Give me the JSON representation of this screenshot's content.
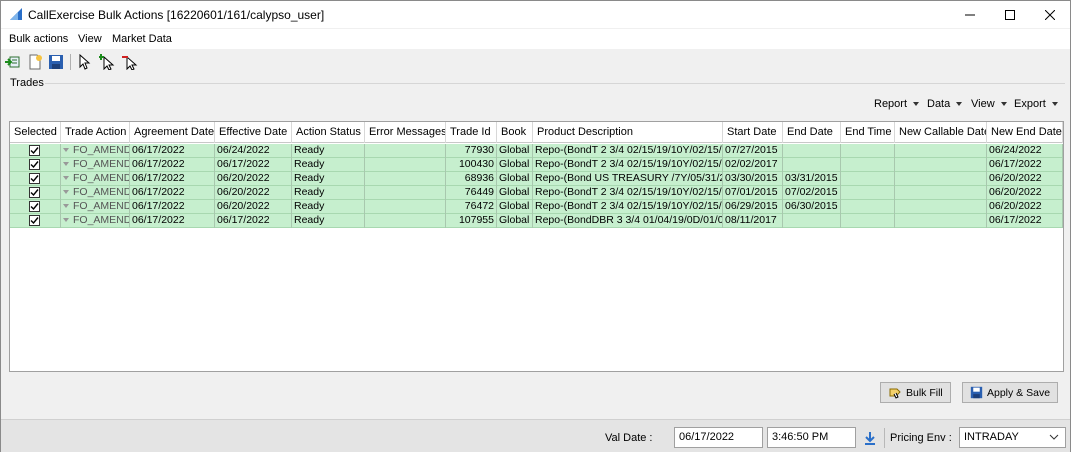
{
  "window": {
    "title": "CallExercise Bulk Actions [16220601/161/calypso_user]",
    "app_icon": "calypso-logo-icon"
  },
  "menu": [
    "Bulk actions",
    "View",
    "Market Data"
  ],
  "toolbar_icons": [
    "import-icon",
    "new-doc-icon",
    "save-icon",
    "pointer-icon",
    "pointer-add-icon",
    "pointer-remove-icon"
  ],
  "group": {
    "title": "Trades"
  },
  "table_actions": [
    "Report",
    "Data",
    "View",
    "Export"
  ],
  "table": {
    "columns": [
      "Selected",
      "Trade Action",
      "Agreement Date",
      "Effective Date",
      "Action Status",
      "Error Messages",
      "Trade Id",
      "Book",
      "Product Description",
      "Start Date",
      "End Date",
      "End Time",
      "New Callable Date",
      "New End Date"
    ],
    "rows": [
      [
        "",
        "FO_AMEND",
        "06/17/2022",
        "06/24/2022",
        "Ready",
        "",
        "77930",
        "Global",
        "Repo-(BondT 2 3/4 02/15/19/10Y/02/15/...",
        "07/27/2015",
        "",
        "",
        "",
        "06/24/2022"
      ],
      [
        "",
        "FO_AMEND",
        "06/17/2022",
        "06/17/2022",
        "Ready",
        "",
        "100430",
        "Global",
        "Repo-(BondT 2 3/4 02/15/19/10Y/02/15/...",
        "02/02/2017",
        "",
        "",
        "",
        "06/17/2022"
      ],
      [
        "",
        "FO_AMEND",
        "06/17/2022",
        "06/20/2022",
        "Ready",
        "",
        "68936",
        "Global",
        "Repo-(Bond US TREASURY /7Y/05/31/201...",
        "03/30/2015",
        "03/31/2015",
        "",
        "",
        "06/20/2022"
      ],
      [
        "",
        "FO_AMEND",
        "06/17/2022",
        "06/20/2022",
        "Ready",
        "",
        "76449",
        "Global",
        "Repo-(BondT 2 3/4 02/15/19/10Y/02/15/...",
        "07/01/2015",
        "07/02/2015",
        "",
        "",
        "06/20/2022"
      ],
      [
        "",
        "FO_AMEND",
        "06/17/2022",
        "06/20/2022",
        "Ready",
        "",
        "76472",
        "Global",
        "Repo-(BondT 2 3/4 02/15/19/10Y/02/15/...",
        "06/29/2015",
        "06/30/2015",
        "",
        "",
        "06/20/2022"
      ],
      [
        "",
        "FO_AMEND",
        "06/17/2022",
        "06/17/2022",
        "Ready",
        "",
        "107955",
        "Global",
        "Repo-(BondDBR 3 3/4 01/04/19/0D/01/04...",
        "08/11/2017",
        "",
        "",
        "",
        "06/17/2022"
      ]
    ],
    "row_color": "#c6efce"
  },
  "buttons": {
    "bulk_fill": "Bulk Fill",
    "apply_save": "Apply & Save"
  },
  "status": {
    "val_date_label": "Val Date :",
    "val_date": "06/17/2022",
    "val_time": "3:46:50 PM",
    "pricing_env_label": "Pricing Env :",
    "pricing_env": "INTRADAY"
  }
}
